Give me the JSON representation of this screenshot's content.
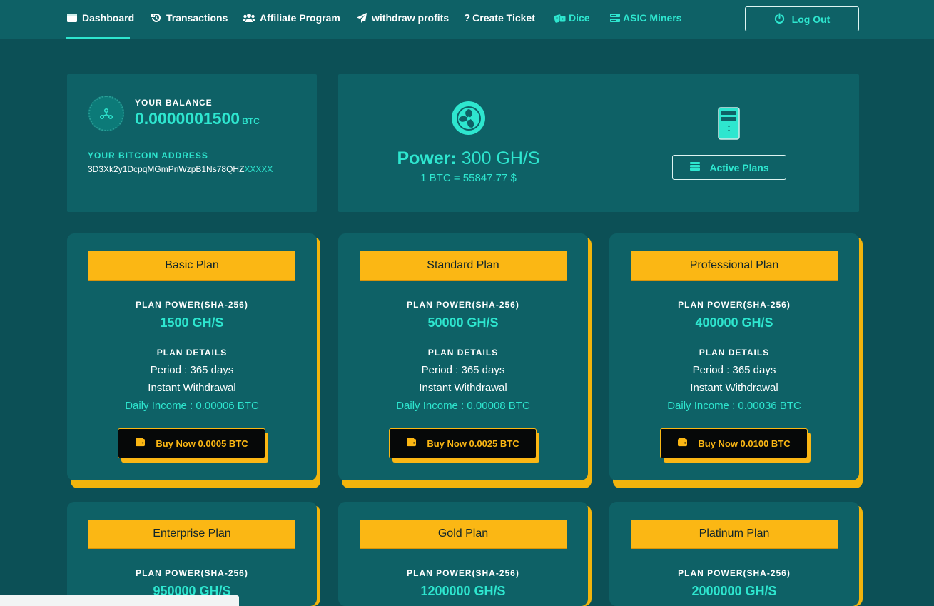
{
  "nav": {
    "items": [
      {
        "label": "Dashboard",
        "icon": "dashboard-icon"
      },
      {
        "label": "Transactions",
        "icon": "history-icon"
      },
      {
        "label": "Affiliate Program",
        "icon": "users-icon"
      },
      {
        "label": "withdraw profits",
        "icon": "paper-plane-icon"
      },
      {
        "label": "Create Ticket",
        "icon": "question-icon"
      },
      {
        "label": "Dice",
        "icon": "dice-icon"
      },
      {
        "label": "ASIC Miners",
        "icon": "server-icon"
      }
    ],
    "logout_label": "Log Out"
  },
  "balance": {
    "label": "YOUR BALANCE",
    "value": "0.0000001500",
    "unit": "BTC",
    "address_label": "YOUR BITCOIN ADDRESS",
    "address_visible": "3D3Xk2y1DcpqMGmPnWzpB1Ns78QHZ",
    "address_masked": "XXXXX"
  },
  "power": {
    "label": "Power:",
    "value": "300 GH/S",
    "rate": "1 BTC = 55847.77 $"
  },
  "active_plans_label": "Active Plans",
  "plans": [
    {
      "name": "Basic Plan",
      "power_label": "PLAN POWER(SHA-256)",
      "power": "1500 GH/S",
      "details_label": "PLAN DETAILS",
      "period": "Period : 365 days",
      "withdrawal": "Instant Withdrawal",
      "income": "Daily Income : 0.00006 BTC",
      "buy_label": "Buy Now 0.0005 BTC"
    },
    {
      "name": "Standard Plan",
      "power_label": "PLAN POWER(SHA-256)",
      "power": "50000 GH/S",
      "details_label": "PLAN DETAILS",
      "period": "Period : 365 days",
      "withdrawal": "Instant Withdrawal",
      "income": "Daily Income : 0.00008 BTC",
      "buy_label": "Buy Now 0.0025 BTC"
    },
    {
      "name": "Professional Plan",
      "power_label": "PLAN POWER(SHA-256)",
      "power": "400000 GH/S",
      "details_label": "PLAN DETAILS",
      "period": "Period : 365 days",
      "withdrawal": "Instant Withdrawal",
      "income": "Daily Income : 0.00036 BTC",
      "buy_label": "Buy Now 0.0100 BTC"
    },
    {
      "name": "Enterprise Plan",
      "power_label": "PLAN POWER(SHA-256)",
      "power": "950000 GH/S"
    },
    {
      "name": "Gold Plan",
      "power_label": "PLAN POWER(SHA-256)",
      "power": "1200000 GH/S"
    },
    {
      "name": "Platinum Plan",
      "power_label": "PLAN POWER(SHA-256)",
      "power": "2000000 GH/S"
    }
  ],
  "colors": {
    "background": "#0c5056",
    "panel": "#0e6166",
    "accent_teal": "#2ee6cf",
    "accent_yellow": "#fbb714"
  }
}
